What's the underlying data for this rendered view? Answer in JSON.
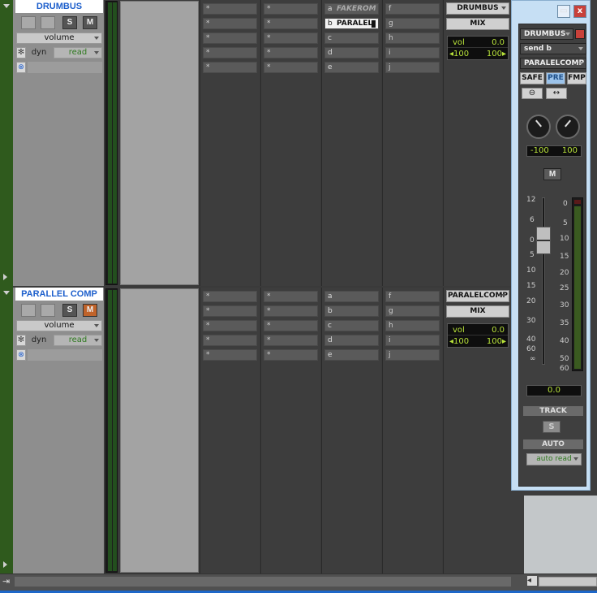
{
  "tracks": [
    {
      "name": "DRUMBUS",
      "solo_label": "S",
      "mute_label": "M",
      "mute_active": false,
      "volume_label": "volume",
      "dyn_label": "dyn",
      "read_label": "read",
      "inserts_a": [
        "*",
        "*",
        "*",
        "*",
        "*"
      ],
      "inserts_b": [
        "*",
        "*",
        "*",
        "*",
        "*"
      ],
      "sends_a": [
        {
          "letter": "a",
          "name": "FAKEROM"
        },
        {
          "letter": "b",
          "name": "PARALEL"
        },
        {
          "letter": "c",
          "name": ""
        },
        {
          "letter": "d",
          "name": ""
        },
        {
          "letter": "e",
          "name": ""
        }
      ],
      "sends_b": [
        "f",
        "g",
        "h",
        "i",
        "j"
      ],
      "io_output": "DRUMBUS",
      "io_mix": "MIX",
      "vol_label": "vol",
      "vol_value": "0.0",
      "pan_left": "◂100",
      "pan_right": "100▸"
    },
    {
      "name": "PARALLEL COMP",
      "solo_label": "S",
      "mute_label": "M",
      "mute_active": true,
      "volume_label": "volume",
      "dyn_label": "dyn",
      "read_label": "read",
      "inserts_a": [
        "*",
        "*",
        "*",
        "*",
        "*"
      ],
      "inserts_b": [
        "*",
        "*",
        "*",
        "*",
        "*"
      ],
      "sends_a": [
        {
          "letter": "a",
          "name": ""
        },
        {
          "letter": "b",
          "name": ""
        },
        {
          "letter": "c",
          "name": ""
        },
        {
          "letter": "d",
          "name": ""
        },
        {
          "letter": "e",
          "name": ""
        }
      ],
      "sends_b": [
        "f",
        "g",
        "h",
        "i",
        "j"
      ],
      "io_output": "PARALELCOMP",
      "io_mix": "MIX",
      "vol_label": "vol",
      "vol_value": "0.0",
      "pan_left": "◂100",
      "pan_right": "100▸"
    }
  ],
  "send_window": {
    "close_label": "x",
    "track_name": "DRUMBUS",
    "send": "send b",
    "destination": "PARALELCOMP",
    "safe_label": "SAFE",
    "pre_label": "PRE",
    "fmp_label": "FMP",
    "pan_left": "-100",
    "pan_right": "100",
    "mute_label": "M",
    "fader_scale": [
      "12",
      "6",
      "0",
      "5",
      "10",
      "15",
      "20",
      "30",
      "40",
      "60",
      "∞"
    ],
    "meter_scale": [
      "0",
      "5",
      "10",
      "15",
      "20",
      "25",
      "30",
      "35",
      "40",
      "50",
      "60"
    ],
    "fader_value": "0.0",
    "track_label": "TRACK",
    "solo_label": "S",
    "auto_label": "AUTO",
    "auto_mode": "auto read"
  },
  "colors": {
    "track_name_text": "#1d5fcc",
    "mute_active": "#c0632a",
    "counter_text": "#b8e23a",
    "read_text": "#2f7a1f"
  }
}
